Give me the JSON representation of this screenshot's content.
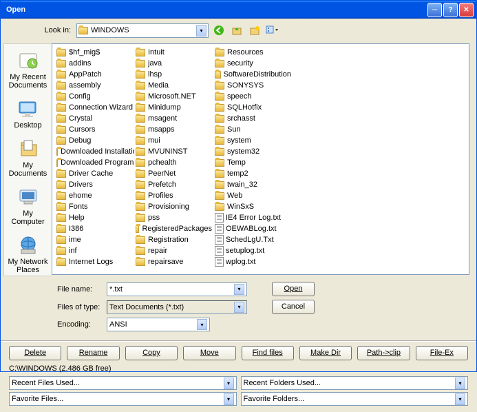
{
  "title": "Open",
  "lookin_label": "Look in:",
  "lookin_value": "WINDOWS",
  "sidebar": [
    {
      "label": "My Recent Documents",
      "icon": "recent"
    },
    {
      "label": "Desktop",
      "icon": "desktop"
    },
    {
      "label": "My Documents",
      "icon": "docs"
    },
    {
      "label": "My Computer",
      "icon": "computer"
    },
    {
      "label": "My Network Places",
      "icon": "network"
    }
  ],
  "files": [
    {
      "n": "$hf_mig$",
      "t": "f"
    },
    {
      "n": "addins",
      "t": "f"
    },
    {
      "n": "AppPatch",
      "t": "f"
    },
    {
      "n": "assembly",
      "t": "f"
    },
    {
      "n": "Config",
      "t": "f"
    },
    {
      "n": "Connection Wizard",
      "t": "f"
    },
    {
      "n": "Crystal",
      "t": "f"
    },
    {
      "n": "Cursors",
      "t": "f"
    },
    {
      "n": "Debug",
      "t": "f"
    },
    {
      "n": "Downloaded Installations",
      "t": "f"
    },
    {
      "n": "Downloaded Program Files",
      "t": "f"
    },
    {
      "n": "Driver Cache",
      "t": "f"
    },
    {
      "n": "Drivers",
      "t": "f"
    },
    {
      "n": "ehome",
      "t": "f"
    },
    {
      "n": "Fonts",
      "t": "f"
    },
    {
      "n": "Help",
      "t": "f"
    },
    {
      "n": "I386",
      "t": "f"
    },
    {
      "n": "ime",
      "t": "f"
    },
    {
      "n": "inf",
      "t": "f"
    },
    {
      "n": "Internet Logs",
      "t": "f"
    },
    {
      "n": "Intuit",
      "t": "f"
    },
    {
      "n": "java",
      "t": "f"
    },
    {
      "n": "lhsp",
      "t": "f"
    },
    {
      "n": "Media",
      "t": "f"
    },
    {
      "n": "Microsoft.NET",
      "t": "f"
    },
    {
      "n": "Minidump",
      "t": "f"
    },
    {
      "n": "msagent",
      "t": "f"
    },
    {
      "n": "msapps",
      "t": "f"
    },
    {
      "n": "mui",
      "t": "f"
    },
    {
      "n": "MVUNINST",
      "t": "f"
    },
    {
      "n": "pchealth",
      "t": "f"
    },
    {
      "n": "PeerNet",
      "t": "f"
    },
    {
      "n": "Prefetch",
      "t": "f"
    },
    {
      "n": "Profiles",
      "t": "f"
    },
    {
      "n": "Provisioning",
      "t": "f"
    },
    {
      "n": "pss",
      "t": "f"
    },
    {
      "n": "RegisteredPackages",
      "t": "f"
    },
    {
      "n": "Registration",
      "t": "f"
    },
    {
      "n": "repair",
      "t": "f"
    },
    {
      "n": "repairsave",
      "t": "f"
    },
    {
      "n": "Resources",
      "t": "f"
    },
    {
      "n": "security",
      "t": "f"
    },
    {
      "n": "SoftwareDistribution",
      "t": "f"
    },
    {
      "n": "SONYSYS",
      "t": "f"
    },
    {
      "n": "speech",
      "t": "f"
    },
    {
      "n": "SQLHotfix",
      "t": "f"
    },
    {
      "n": "srchasst",
      "t": "f"
    },
    {
      "n": "Sun",
      "t": "f"
    },
    {
      "n": "system",
      "t": "f"
    },
    {
      "n": "system32",
      "t": "f"
    },
    {
      "n": "Temp",
      "t": "f"
    },
    {
      "n": "temp2",
      "t": "f"
    },
    {
      "n": "twain_32",
      "t": "f"
    },
    {
      "n": "Web",
      "t": "f"
    },
    {
      "n": "WinSxS",
      "t": "f"
    },
    {
      "n": "IE4 Error Log.txt",
      "t": "t"
    },
    {
      "n": "OEWABLog.txt",
      "t": "t"
    },
    {
      "n": "SchedLgU.Txt",
      "t": "t"
    },
    {
      "n": "setuplog.txt",
      "t": "t"
    },
    {
      "n": "wplog.txt",
      "t": "t"
    }
  ],
  "filename_label": "File name:",
  "filename_value": "*.txt",
  "filetype_label": "Files of type:",
  "filetype_value": "Text Documents (*.txt)",
  "encoding_label": "Encoding:",
  "encoding_value": "ANSI",
  "open_btn": "Open",
  "cancel_btn": "Cancel",
  "ext_buttons": [
    "Delete",
    "Rename",
    "Copy",
    "Move",
    "Find files",
    "Make Dir",
    "Path->clip",
    "File-Ex"
  ],
  "path_text": "C:\\WINDOWS   (2.486 GB free)",
  "recent_files": "Recent Files Used...",
  "recent_folders": "Recent Folders Used...",
  "fav_files": "Favorite Files...",
  "fav_folders": "Favorite Folders..."
}
